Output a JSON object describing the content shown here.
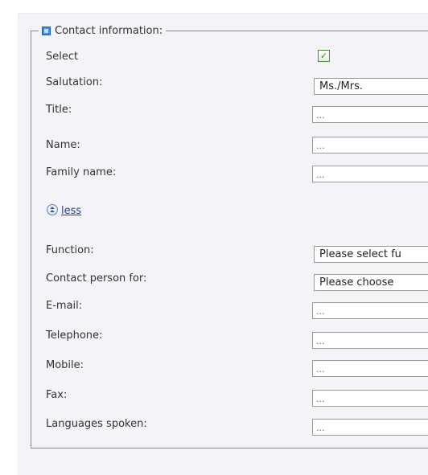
{
  "section": {
    "legend": "Contact information:"
  },
  "fields": {
    "select": {
      "label": "Select",
      "checked": true,
      "check_mark": "✓"
    },
    "salutation": {
      "label": "Salutation:",
      "value": "Ms./Mrs."
    },
    "title": {
      "label": "Title:",
      "value": "..."
    },
    "name": {
      "label": "Name:",
      "value": "..."
    },
    "family_name": {
      "label": "Family name:",
      "value": "..."
    },
    "function": {
      "label": "Function:",
      "value": "Please select fu"
    },
    "contact_person_for": {
      "label": "Contact person for:",
      "value": "Please choose"
    },
    "email": {
      "label": "E-mail:",
      "value": "..."
    },
    "telephone": {
      "label": "Telephone:",
      "value": "..."
    },
    "mobile": {
      "label": "Mobile:",
      "value": "..."
    },
    "fax": {
      "label": "Fax:",
      "value": "..."
    },
    "languages_spoken": {
      "label": "Languages spoken:",
      "value": "..."
    }
  },
  "toggle": {
    "label": "less",
    "icon": "collapse-up-icon"
  },
  "colors": {
    "panel_background": "#f3f3f8",
    "link": "#1f3f9a",
    "checkbox_check": "#2e8a2e",
    "section_toggle": "#3a8de0"
  }
}
